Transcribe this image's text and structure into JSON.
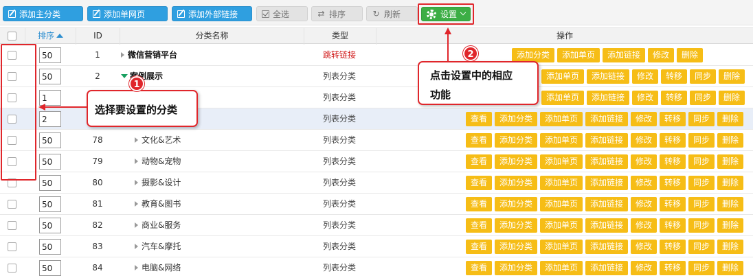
{
  "toolbar": {
    "add_main_category": "添加主分类",
    "add_single_page": "添加单网页",
    "add_external_link": "添加外部链接",
    "select_all": "全选",
    "sort": "排序",
    "refresh": "刷新",
    "settings": "设置"
  },
  "columns": {
    "sort": "排序",
    "id": "ID",
    "name": "分类名称",
    "type": "类型",
    "actions": "操作"
  },
  "actions": {
    "view": "查看",
    "add_category": "添加分类",
    "add_page": "添加单页",
    "add_link": "添加链接",
    "edit": "修改",
    "move": "转移",
    "sync": "同步",
    "delete": "删除"
  },
  "rows": [
    {
      "sort": "50",
      "id": "1",
      "name": "微信营销平台",
      "type": "跳转链接"
    },
    {
      "sort": "50",
      "id": "2",
      "name": "案例展示",
      "type": "列表分类"
    },
    {
      "sort": "1",
      "id": "",
      "name": "",
      "type": "列表分类"
    },
    {
      "sort": "2",
      "id": "",
      "name": "",
      "type": "列表分类"
    },
    {
      "sort": "50",
      "id": "78",
      "name": "文化&艺术",
      "type": "列表分类"
    },
    {
      "sort": "50",
      "id": "79",
      "name": "动物&宠物",
      "type": "列表分类"
    },
    {
      "sort": "50",
      "id": "80",
      "name": "摄影&设计",
      "type": "列表分类"
    },
    {
      "sort": "50",
      "id": "81",
      "name": "教育&图书",
      "type": "列表分类"
    },
    {
      "sort": "50",
      "id": "82",
      "name": "商业&服务",
      "type": "列表分类"
    },
    {
      "sort": "50",
      "id": "83",
      "name": "汽车&摩托",
      "type": "列表分类"
    },
    {
      "sort": "50",
      "id": "84",
      "name": "电脑&网络",
      "type": "列表分类"
    }
  ],
  "annotations": {
    "step1_number": "1",
    "step1_text": "选择要设置的分类",
    "step2_number": "2",
    "step2_text_line1": "点击设置中的相应",
    "step2_text_line2": "功能"
  },
  "colors": {
    "toolbar_blue": "#2f9fe0",
    "settings_green": "#3cae45",
    "action_yellow": "#f6bd16",
    "annotation_red": "#e0262b",
    "link_type_red": "#d01818"
  }
}
